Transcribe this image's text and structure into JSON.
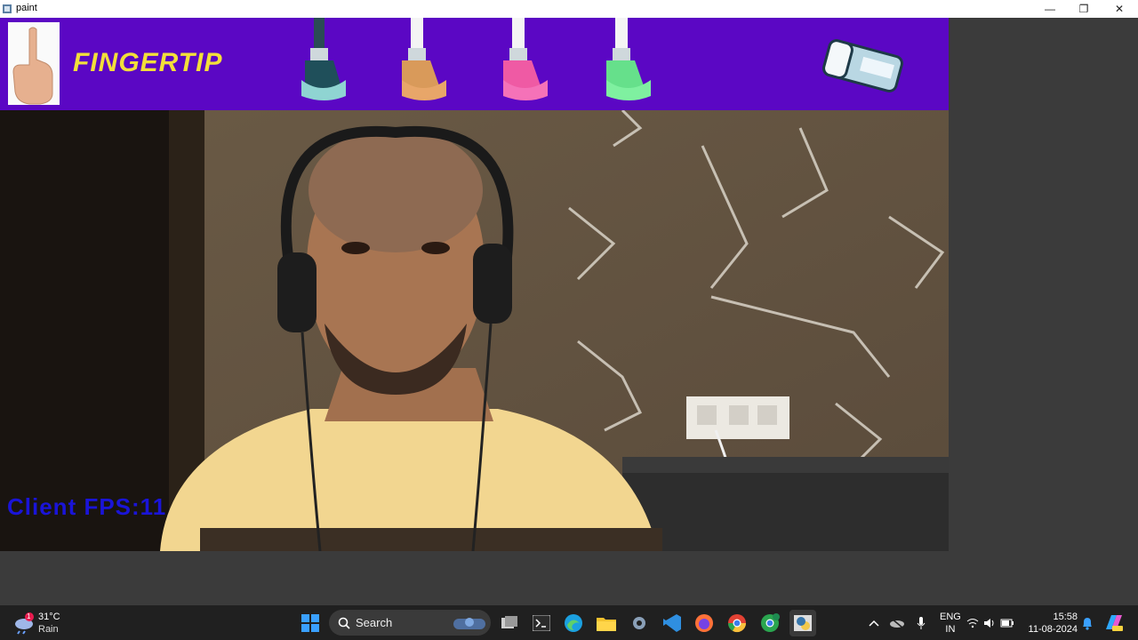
{
  "window": {
    "title": "paint",
    "controls": [
      "minimize",
      "restore",
      "close"
    ]
  },
  "header": {
    "brand_label": "FINGERTIP",
    "brush_colors": [
      "#1f4f5a",
      "#d99a5a",
      "#ef5aa4",
      "#66e08b"
    ],
    "background": "#5b07c4",
    "eraser": "eraser-icon"
  },
  "overlay": {
    "fps_text": "Client FPS:11"
  },
  "taskbar": {
    "weather": {
      "temp": "31°C",
      "condition": "Rain",
      "badge": "1"
    },
    "search_label": "Search",
    "language": {
      "line1": "ENG",
      "line2": "IN"
    },
    "time": "15:58",
    "date": "11-08-2024",
    "pinned_apps": [
      "start-icon",
      "search",
      "task-view-icon",
      "terminal-icon",
      "edge-icon",
      "file-explorer-icon",
      "settings-icon",
      "vscode-icon",
      "firefox-icon",
      "chrome-icon",
      "chrome-profile-icon",
      "python-app-icon"
    ]
  }
}
